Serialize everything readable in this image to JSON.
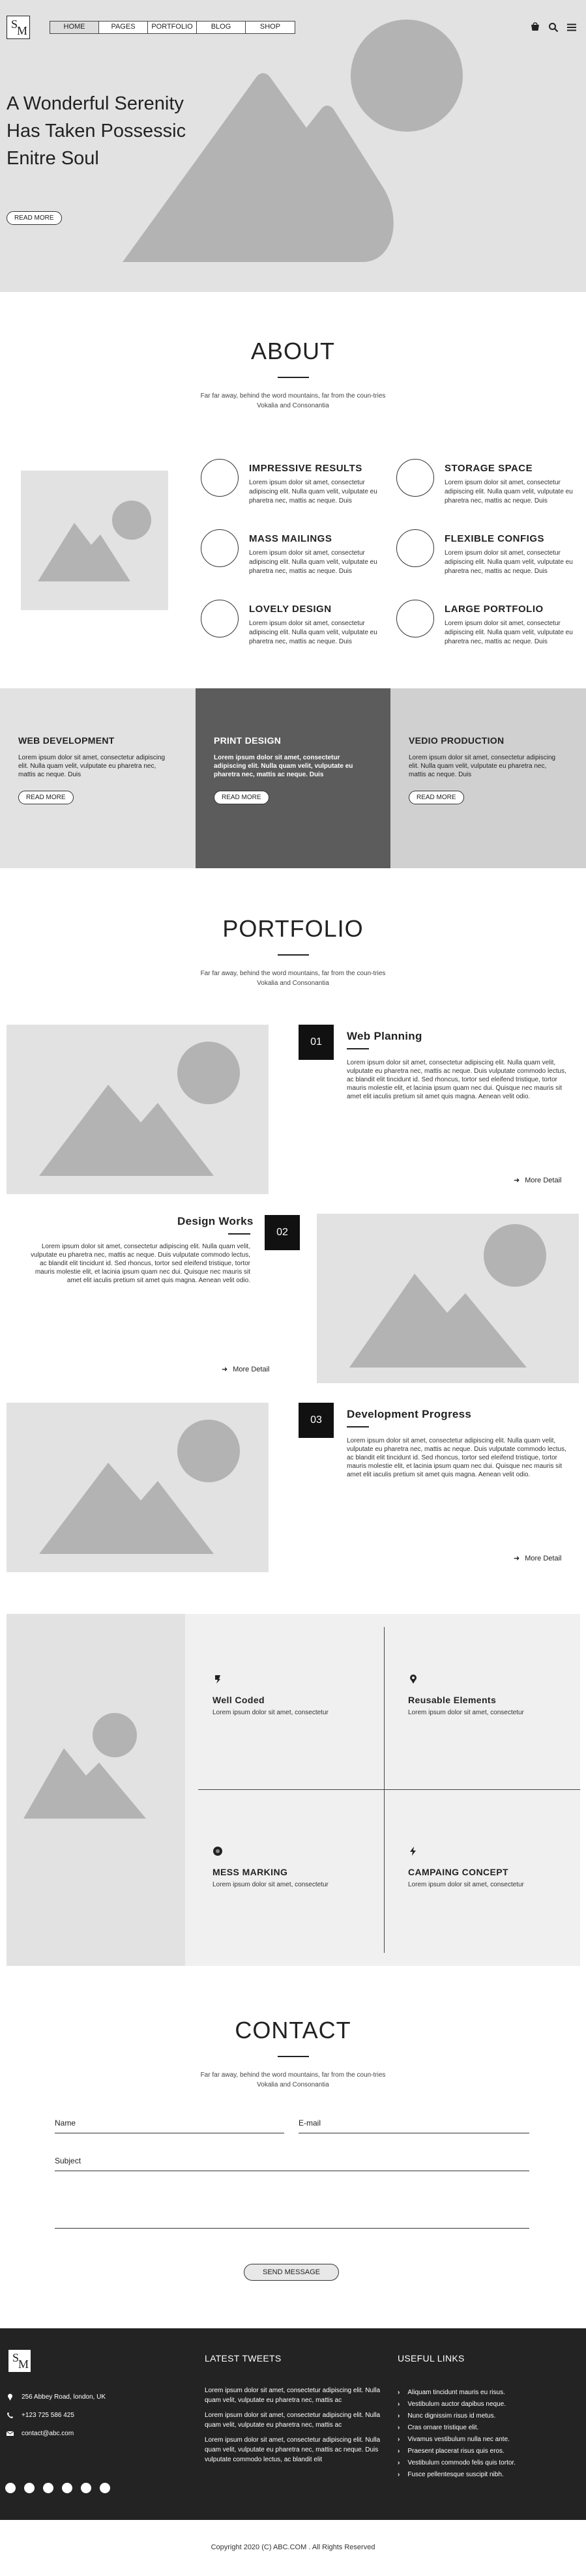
{
  "brand": {
    "logo_s": "S",
    "logo_m": "M"
  },
  "nav": {
    "items": [
      {
        "label": "HOME",
        "active": true
      },
      {
        "label": "PAGES",
        "active": false
      },
      {
        "label": "PORTFOLIO",
        "active": false
      },
      {
        "label": "BLOG",
        "active": false
      },
      {
        "label": "SHOP",
        "active": false
      }
    ],
    "icons": [
      "cart-icon",
      "search-icon",
      "menu-icon"
    ]
  },
  "hero": {
    "title": "A Wonderful Serenity Has Taken Possessic Enitre Soul",
    "button": "READ MORE"
  },
  "about": {
    "heading": "ABOUT",
    "subtitle_line1": "Far far away, behind the word mountains, far from the coun-tries",
    "subtitle_line2": "Vokalia and Consonantia",
    "features": [
      {
        "title": "IMPRESSIVE RESULTS",
        "text": "Lorem ipsum dolor sit amet, consectetur adipiscing elit. Nulla quam velit, vulputate eu pharetra nec, mattis ac neque. Duis"
      },
      {
        "title": "STORAGE SPACE",
        "text": "Lorem ipsum dolor sit amet, consectetur adipiscing elit. Nulla quam velit, vulputate eu pharetra nec, mattis ac neque. Duis"
      },
      {
        "title": "MASS MAILINGS",
        "text": "Lorem ipsum dolor sit amet, consectetur adipiscing elit. Nulla quam velit, vulputate eu pharetra nec, mattis ac neque. Duis"
      },
      {
        "title": "FLEXIBLE CONFIGS",
        "text": "Lorem ipsum dolor sit amet, consectetur adipiscing elit. Nulla quam velit, vulputate eu pharetra nec, mattis ac neque. Duis"
      },
      {
        "title": "LOVELY DESIGN",
        "text": "Lorem ipsum dolor sit amet, consectetur adipiscing elit. Nulla quam velit, vulputate eu pharetra nec, mattis ac neque. Duis"
      },
      {
        "title": "LARGE PORTFOLIO",
        "text": "Lorem ipsum dolor sit amet, consectetur adipiscing elit. Nulla quam velit, vulputate eu pharetra nec, mattis ac neque. Duis"
      }
    ]
  },
  "services": [
    {
      "title": "WEB DEVELOPMENT",
      "text": "Lorem ipsum dolor sit amet, consectetur adipiscing elit. Nulla quam velit, vulputate eu pharetra nec, mattis ac neque. Duis",
      "button": "READ MORE"
    },
    {
      "title": "PRINT DESIGN",
      "text": "Lorem ipsum dolor sit amet, consectetur adipiscing elit. Nulla quam velit, vulputate eu pharetra nec, mattis ac neque. Duis",
      "button": "READ MORE"
    },
    {
      "title": "VEDIO PRODUCTION",
      "text": "Lorem ipsum dolor sit amet, consectetur adipiscing elit. Nulla quam velit, vulputate eu pharetra nec, mattis ac neque. Duis",
      "button": "READ MORE"
    }
  ],
  "portfolio": {
    "heading": "PORTFOLIO",
    "subtitle_line1": "Far far away, behind the word mountains, far from the coun-tries",
    "subtitle_line2": "Vokalia and Consonantia",
    "items": [
      {
        "number": "01",
        "title": "Web Planning",
        "text": "Lorem ipsum dolor sit amet, consectetur adipiscing elit. Nulla quam velit, vulputate eu pharetra nec, mattis ac neque. Duis vulputate commodo lectus, ac blandit elit tincidunt id. Sed rhoncus, tortor sed eleifend tristique, tortor mauris molestie elit, et lacinia ipsum quam nec dui. Quisque nec mauris sit amet elit iaculis pretium sit amet quis magna. Aenean velit odio.",
        "more": "More Detail"
      },
      {
        "number": "02",
        "title": "Design Works",
        "text": "Lorem ipsum dolor sit amet, consectetur adipiscing elit. Nulla quam velit, vulputate eu pharetra nec, mattis ac neque. Duis vulputate commodo lectus, ac blandit elit tincidunt id. Sed rhoncus, tortor sed eleifend tristique, tortor mauris molestie elit, et lacinia ipsum quam nec dui. Quisque nec mauris sit amet elit iaculis pretium sit amet quis magna. Aenean velit odio.",
        "more": "More Detail"
      },
      {
        "number": "03",
        "title": "Development Progress",
        "text": "Lorem ipsum dolor sit amet, consectetur adipiscing elit. Nulla quam velit, vulputate eu pharetra nec, mattis ac neque. Duis vulputate commodo lectus, ac blandit elit tincidunt id. Sed rhoncus, tortor sed eleifend tristique, tortor mauris molestie elit, et lacinia ipsum quam nec dui. Quisque nec mauris sit amet elit iaculis pretium sit amet quis magna. Aenean velit odio.",
        "more": "More Detail"
      }
    ]
  },
  "features_grid": [
    {
      "title": "Well Coded",
      "text": "Lorem ipsum dolor sit amet, consectetur",
      "icon": "pen-nib-icon"
    },
    {
      "title": "Reusable Elements",
      "text": "Lorem ipsum dolor sit amet, consectetur",
      "icon": "location-pin-icon"
    },
    {
      "title": "MESS MARKING",
      "text": "Lorem ipsum dolor sit amet, consectetur",
      "icon": "gear-icon"
    },
    {
      "title": "CAMPAING CONCEPT",
      "text": "Lorem ipsum dolor sit amet, consectetur",
      "icon": "bolt-icon"
    }
  ],
  "contact": {
    "heading": "CONTACT",
    "subtitle_line1": "Far far away, behind the word mountains, far from the coun-tries",
    "subtitle_line2": "Vokalia and Consonantia",
    "name_label": "Name",
    "email_label": "E-mail",
    "subject_label": "Subject",
    "send_button": "SEND MESSAGE"
  },
  "footer": {
    "address": "256 Abbey Road, london, UK",
    "phone": "+123 725 586 425",
    "email": "contact@abc.com",
    "tweets_title": "LATEST TWEETS",
    "tweets": [
      "Lorem ipsum dolor sit amet, consectetur adipiscing elit. Nulla quam velit, vulputate eu pharetra nec, mattis ac",
      "Lorem ipsum dolor sit amet, consectetur adipiscing elit. Nulla quam velit, vulputate eu pharetra nec, mattis ac",
      "Lorem ipsum dolor sit amet, consectetur adipiscing elit. Nulla quam velit, vulputate eu pharetra nec, mattis ac neque. Duis vulputate commodo lectus, ac blandit elit"
    ],
    "links_title": "USEFUL LINKS",
    "links": [
      "Aliquam tincidunt mauris eu risus.",
      "Vestibulum auctor dapibus neque.",
      "Nunc dignissim risus id metus.",
      "Cras ornare tristique elit.",
      "Vivamus vestibulum nulla nec ante.",
      "Praesent placerat risus quis eros.",
      "Vestibulum commodo felis quis tortor.",
      "Fusce pellentesque suscipit nibh."
    ],
    "social_count": 6,
    "copyright": "Copyright 2020 (C) ABC.COM . All Rights Reserved"
  }
}
